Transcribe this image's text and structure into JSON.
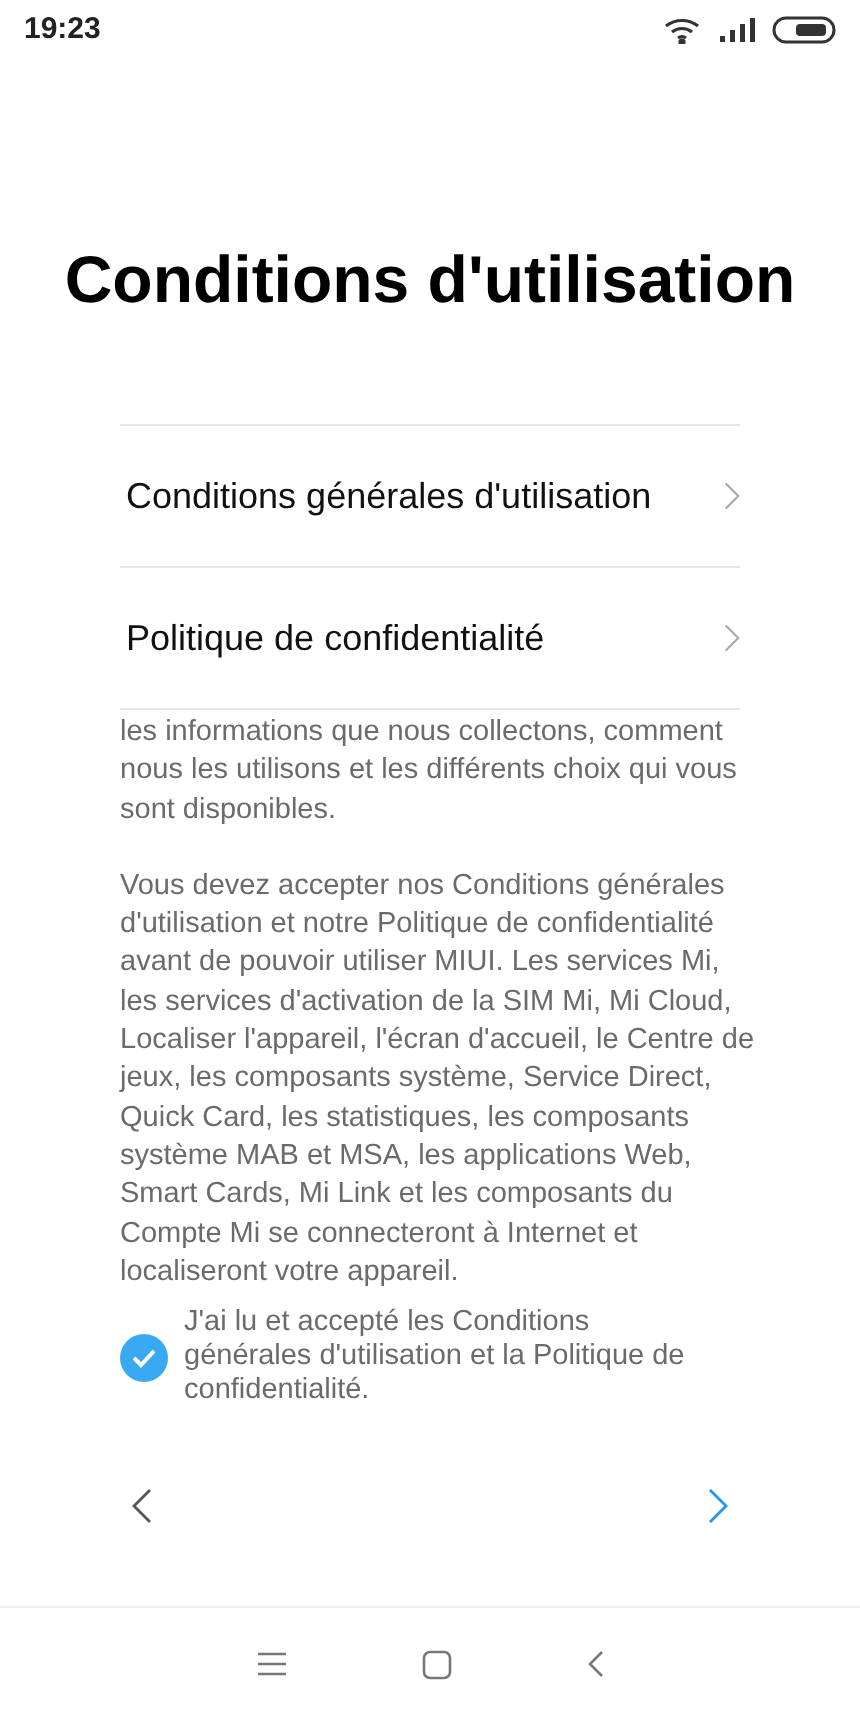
{
  "status_bar": {
    "time": "19:23"
  },
  "title": "Conditions d'utilisation",
  "links": [
    {
      "label": "Conditions générales d'utilisation"
    },
    {
      "label": "Politique de confidentialité"
    }
  ],
  "paragraphs": [
    "les informations que nous collectons, comment nous les utilisons et les différents choix qui vous sont disponibles.",
    "Vous devez accepter nos Conditions générales d'utilisation et notre Politique de confidentialité avant de pouvoir utiliser MIUI. Les services Mi, les services d'activation de la SIM Mi, Mi Cloud, Localiser l'appareil, l'écran d'accueil, le Centre de jeux, les composants système, Service Direct, Quick Card, les statistiques, les composants système MAB et MSA, les applications Web, Smart Cards, Mi Link et les composants du Compte Mi se connecteront à Internet et localiseront votre appareil."
  ],
  "agreement": {
    "label": "J'ai lu et accepté les Conditions générales d'utilisation et la Politique de confidentialité.",
    "checked": true
  }
}
